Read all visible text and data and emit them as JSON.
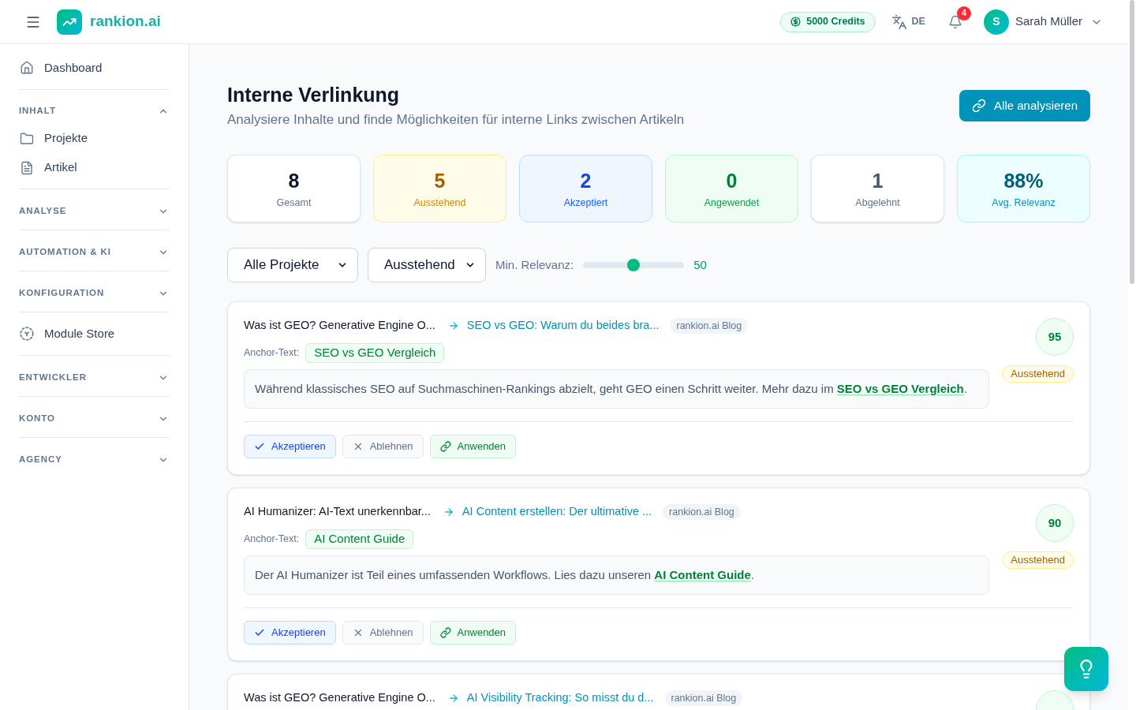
{
  "topbar": {
    "brand": "rankion.ai",
    "credits": "5000 Credits",
    "language": "DE",
    "notification_count": "4",
    "user": {
      "initial": "S",
      "name": "Sarah Müller"
    }
  },
  "sidebar": {
    "items": [
      {
        "kind": "link",
        "label": "Dashboard"
      },
      {
        "kind": "section",
        "label": "INHALT",
        "expanded": true,
        "items": [
          {
            "label": "Projekte"
          },
          {
            "label": "Artikel"
          }
        ]
      },
      {
        "kind": "section",
        "label": "ANALYSE",
        "expanded": false
      },
      {
        "kind": "section",
        "label": "AUTOMATION & KI",
        "expanded": false
      },
      {
        "kind": "section",
        "label": "KONFIGURATION",
        "expanded": false
      },
      {
        "kind": "link",
        "label": "Module Store"
      },
      {
        "kind": "section",
        "label": "ENTWICKLER",
        "expanded": false
      },
      {
        "kind": "section",
        "label": "KONTO",
        "expanded": false
      },
      {
        "kind": "section",
        "label": "AGENCY",
        "expanded": false
      }
    ]
  },
  "header": {
    "title": "Interne Verlinkung",
    "subtitle": "Analysiere Inhalte und finde Möglichkeiten für interne Links zwischen Artikeln",
    "action": "Alle analysieren"
  },
  "stats": [
    {
      "kind": "total",
      "value": "8",
      "label": "Gesamt"
    },
    {
      "kind": "pending",
      "value": "5",
      "label": "Ausstehend"
    },
    {
      "kind": "accepted",
      "value": "2",
      "label": "Akzeptiert"
    },
    {
      "kind": "applied",
      "value": "0",
      "label": "Angewendet"
    },
    {
      "kind": "rejected",
      "value": "1",
      "label": "Abgelehnt"
    },
    {
      "kind": "relevance",
      "value": "88%",
      "label": "Avg. Relevanz"
    }
  ],
  "filters": {
    "project": "Alle Projekte",
    "status": "Ausstehend",
    "relevance": {
      "label": "Min. Relevanz:",
      "level": 0.5,
      "reading": "50"
    }
  },
  "suggestions": [
    {
      "source": "Was ist GEO? Generative Engine O...",
      "target": "SEO vs GEO: Warum du beides bra...",
      "site": "rankion.ai Blog",
      "anchor_label": "Anchor-Text:",
      "anchor": "SEO vs GEO Vergleich",
      "context": {
        "before": "Während klassisches SEO auf Suchmaschinen-Rankings abzielt, geht GEO einen Schritt weiter. Mehr dazu im ",
        "link": "SEO vs GEO Vergleich",
        "after": "."
      },
      "score": "95",
      "status": {
        "kind": "pending",
        "label": "Ausstehend"
      },
      "actions": [
        {
          "kind": "accept",
          "label": "Akzeptieren"
        },
        {
          "kind": "reject",
          "label": "Ablehnen"
        },
        {
          "kind": "apply",
          "label": "Anwenden"
        }
      ]
    },
    {
      "source": "AI Humanizer: AI-Text unerkennbar...",
      "target": "AI Content erstellen: Der ultimative ...",
      "site": "rankion.ai Blog",
      "anchor_label": "Anchor-Text:",
      "anchor": "AI Content Guide",
      "context": {
        "before": "Der AI Humanizer ist Teil eines umfassenden Workflows. Lies dazu unseren ",
        "link": "AI Content Guide",
        "after": "."
      },
      "score": "90",
      "status": {
        "kind": "pending",
        "label": "Ausstehend"
      },
      "actions": [
        {
          "kind": "accept",
          "label": "Akzeptieren"
        },
        {
          "kind": "reject",
          "label": "Ablehnen"
        },
        {
          "kind": "apply",
          "label": "Anwenden"
        }
      ]
    },
    {
      "source": "Was ist GEO? Generative Engine O...",
      "target": "AI Visibility Tracking: So misst du d...",
      "site": "rankion.ai Blog"
    }
  ]
}
